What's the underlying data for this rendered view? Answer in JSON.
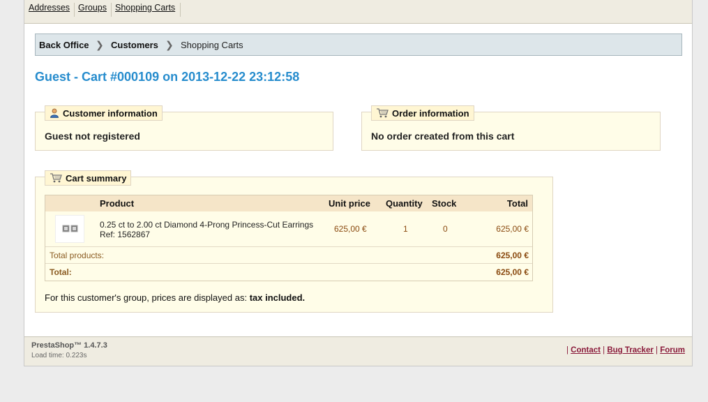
{
  "subnav": {
    "tabs": [
      "Addresses",
      "Groups",
      "Shopping Carts"
    ]
  },
  "breadcrumb": {
    "items": [
      "Back Office",
      "Customers",
      "Shopping Carts"
    ],
    "separator": "❯"
  },
  "title": "Guest - Cart #000109 on 2013-12-22 23:12:58",
  "customer_info": {
    "legend": "Customer information",
    "text": "Guest not registered",
    "icon": "user-icon"
  },
  "order_info": {
    "legend": "Order information",
    "text": "No order created from this cart",
    "icon": "cart-icon"
  },
  "cart_summary": {
    "legend": "Cart summary",
    "icon": "cart-icon",
    "columns": [
      "Product",
      "Unit price",
      "Quantity",
      "Stock",
      "Total"
    ],
    "rows": [
      {
        "name": "0.25 ct to 2.00 ct Diamond 4-Prong Princess-Cut Earrings",
        "ref": "Ref: 1562867",
        "unit_price": "625,00 €",
        "quantity": "1",
        "stock": "0",
        "total": "625,00 €"
      }
    ],
    "total_products_label": "Total products:",
    "total_products_value": "625,00 €",
    "total_label": "Total:",
    "total_value": "625,00 €",
    "tax_note_prefix": "For this customer's group, prices are displayed as:",
    "tax_note_value": "tax included."
  },
  "footer": {
    "version": "PrestaShop™ 1.4.7.3",
    "load_time": "Load time: 0.223s",
    "links": [
      "Contact",
      "Bug Tracker",
      "Forum"
    ]
  },
  "colors": {
    "title": "#268ccd",
    "fieldset_bg": "#fffde8",
    "breadcrumb_bg": "#dde6ea",
    "footer_link": "#8a1a3a"
  }
}
